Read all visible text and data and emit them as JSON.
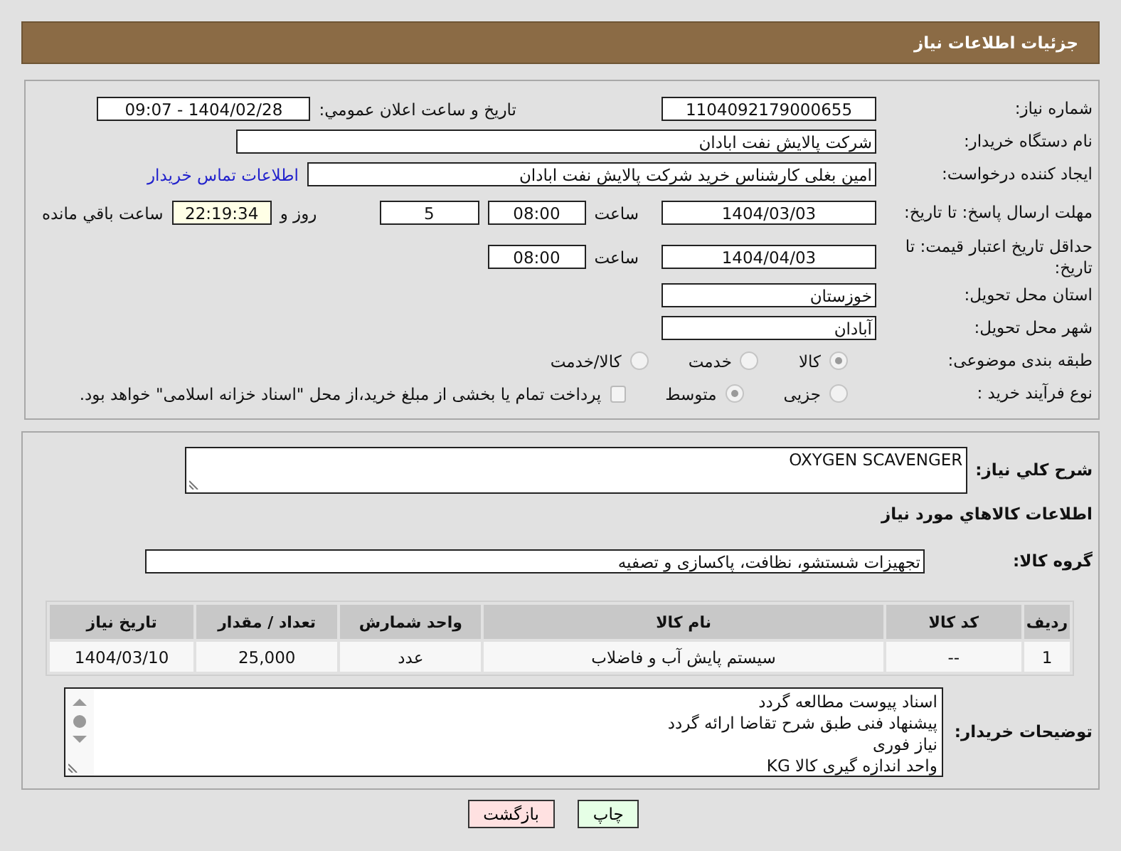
{
  "header": {
    "title": "جزئیات اطلاعات نیاز"
  },
  "request_number": {
    "label": "شماره نیاز:",
    "value": "1104092179000655"
  },
  "announce": {
    "label": "تاریخ و ساعت اعلان عمومي:",
    "value": "1404/02/28 - 09:07"
  },
  "buyer_org": {
    "label": "نام دستگاه خریدار:",
    "value": "شرکت پالایش نفت ابادان"
  },
  "creator": {
    "label": "ایجاد کننده درخواست:",
    "value": "امین بغلی کارشناس خرید شرکت پالایش نفت ابادان"
  },
  "contact_link": "اطلاعات تماس خریدار",
  "reply_deadline": {
    "label": "مهلت ارسال پاسخ: تا تاریخ:",
    "date": "1404/03/03",
    "time_label": "ساعت",
    "time": "08:00",
    "days": "5",
    "days_label": "روز و",
    "remaining": "22:19:34",
    "remaining_label": "ساعت باقي مانده"
  },
  "price_validity": {
    "label": "حداقل تاریخ اعتبار قیمت: تا تاریخ:",
    "date": "1404/04/03",
    "time_label": "ساعت",
    "time": "08:00"
  },
  "province": {
    "label": "استان محل تحویل:",
    "value": "خوزستان"
  },
  "city": {
    "label": "شهر محل تحویل:",
    "value": "آبادان"
  },
  "category": {
    "label": "طبقه بندی موضوعی:",
    "options": [
      {
        "label": "کالا",
        "selected": true
      },
      {
        "label": "خدمت",
        "selected": false
      },
      {
        "label": "کالا/خدمت",
        "selected": false
      }
    ]
  },
  "purchase_type": {
    "label": "نوع فرآیند خرید :",
    "options": [
      {
        "label": "جزیی",
        "selected": false
      },
      {
        "label": "متوسط",
        "selected": true
      }
    ],
    "treasury": {
      "label": "پرداخت تمام یا بخشی از مبلغ خرید،از محل \"اسناد خزانه اسلامی\" خواهد بود.",
      "checked": false
    }
  },
  "description": {
    "label": "شرح کلي نياز:",
    "value": "OXYGEN SCAVENGER"
  },
  "goods_heading": "اطلاعات كالاهاي مورد نياز",
  "goods_group": {
    "label": "گروه کالا:",
    "value": "تجهیزات شستشو، نظافت، پاکسازی و تصفیه"
  },
  "table": {
    "columns": [
      "رديف",
      "کد کالا",
      "نام کالا",
      "واحد شمارش",
      "تعداد / مقدار",
      "تاریخ نیاز"
    ],
    "rows": [
      [
        "1",
        "--",
        "سیستم پایش آب و فاضلاب",
        "عدد",
        "25,000",
        "1404/03/10"
      ]
    ]
  },
  "buyer_notes": {
    "label": "توضیحات خریدار:",
    "lines": [
      "اسناد پیوست مطالعه گردد",
      "پیشنهاد فنی طبق شرح تقاضا ارائه گردد",
      "نیاز فوری",
      "واحد اندازه گیری کالا KG"
    ]
  },
  "buttons": [
    {
      "label": "چاپ",
      "kind": "print"
    },
    {
      "label": "بازگشت",
      "kind": "back"
    }
  ]
}
